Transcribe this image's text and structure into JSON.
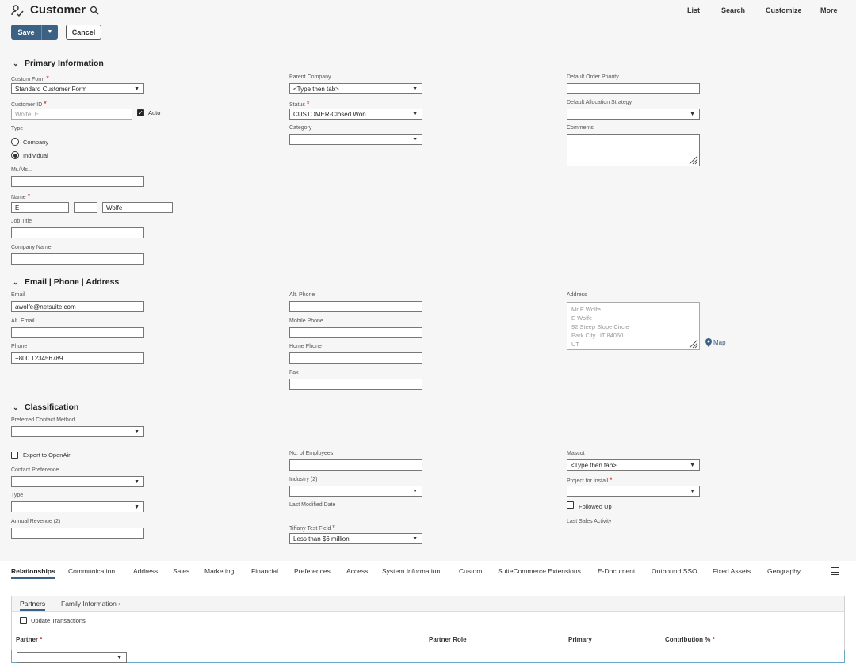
{
  "header": {
    "title": "Customer",
    "nav": [
      "List",
      "Search",
      "Customize",
      "More"
    ]
  },
  "actions": {
    "save": "Save",
    "cancel": "Cancel"
  },
  "primary": {
    "title": "Primary Information",
    "custom_form_label": "Custom Form",
    "custom_form_value": "Standard Customer Form",
    "customer_id_label": "Customer ID",
    "customer_id_placeholder": "Wolfe, E",
    "auto_label": "Auto",
    "type_label": "Type",
    "type_company": "Company",
    "type_individual": "Individual",
    "mr_label": "Mr./Ms...",
    "name_label": "Name",
    "first_name": "E",
    "middle_name": "",
    "last_name": "Wolfe",
    "job_title_label": "Job Title",
    "company_name_label": "Company Name",
    "parent_company_label": "Parent Company",
    "parent_company_value": "<Type then tab>",
    "status_label": "Status",
    "status_value": "CUSTOMER-Closed Won",
    "category_label": "Category",
    "default_order_priority_label": "Default Order Priority",
    "default_alloc_label": "Default Allocation Strategy",
    "comments_label": "Comments"
  },
  "contact": {
    "title": "Email | Phone | Address",
    "email_label": "Email",
    "email_value": "awolfe@netsuite.com",
    "alt_email_label": "Alt. Email",
    "phone_label": "Phone",
    "phone_value": "+800 123456789",
    "alt_phone_label": "Alt. Phone",
    "mobile_phone_label": "Mobile Phone",
    "home_phone_label": "Home Phone",
    "fax_label": "Fax",
    "address_label": "Address",
    "address_lines": [
      "Mr E Wolfe",
      "E Wolfe",
      "92 Steep Slope Circle",
      "Park City UT 84060",
      "UT"
    ],
    "map_label": "Map"
  },
  "classification": {
    "title": "Classification",
    "preferred_contact_label": "Preferred Contact Method",
    "export_openair_label": "Export to OpenAir",
    "contact_pref_label": "Contact Preference",
    "type_label": "Type",
    "annual_revenue_label": "Annual Revenue (2)",
    "employees_label": "No. of Employees",
    "industry_label": "Industry (2)",
    "last_modified_label": "Last Modified Date",
    "tiffany_label": "Tiffany Test Field",
    "tiffany_value": "Less than $6 million",
    "mascot_label": "Mascot",
    "mascot_value": "<Type then tab>",
    "project_install_label": "Project for Install",
    "followed_up_label": "Followed Up",
    "last_sales_label": "Last Sales Activity"
  },
  "tabs": [
    "Relationships",
    "Communication",
    "Address",
    "Sales",
    "Marketing",
    "Financial",
    "Preferences",
    "Access",
    "System Information",
    "Custom",
    "SuiteCommerce Extensions",
    "E-Document",
    "Outbound SSO",
    "Fixed Assets",
    "Geography"
  ],
  "subtabs": [
    "Partners",
    "Family Information"
  ],
  "subtab_marker": "•",
  "update_transactions_label": "Update Transactions",
  "columns": [
    "Partner",
    "Partner Role",
    "Primary",
    "Contribution %"
  ],
  "required_mark": "*"
}
